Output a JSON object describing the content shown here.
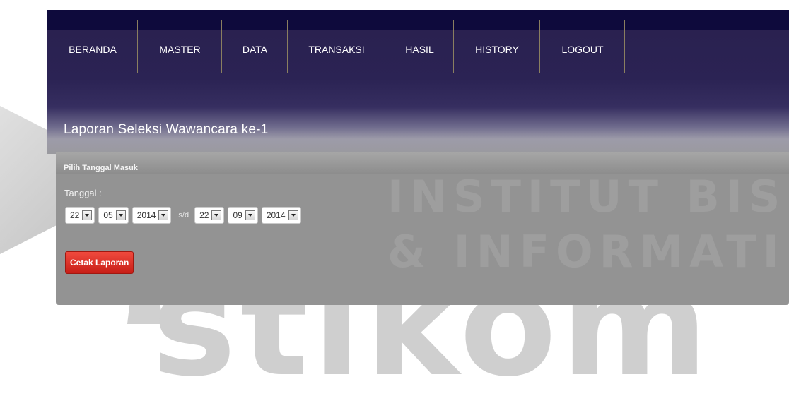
{
  "watermark": {
    "line1": "INSTITUT BISNIS",
    "line2": "& INFORMATIKA",
    "big": "stikom"
  },
  "nav": {
    "items": [
      {
        "label": "BERANDA"
      },
      {
        "label": "MASTER"
      },
      {
        "label": "DATA"
      },
      {
        "label": "TRANSAKSI"
      },
      {
        "label": "HASIL"
      },
      {
        "label": "HISTORY"
      },
      {
        "label": "LOGOUT"
      }
    ]
  },
  "page": {
    "title": "Laporan Seleksi Wawancara ke-1"
  },
  "form": {
    "section_title": "Pilih Tanggal Masuk",
    "date_label": "Tanggal :",
    "from": {
      "day": "22",
      "month": "05",
      "year": "2014"
    },
    "separator": "s/d",
    "to": {
      "day": "22",
      "month": "09",
      "year": "2014"
    },
    "submit_label": "Cetak Laporan"
  },
  "colors": {
    "topbar": "#0e0a3c",
    "header": "#2b2354",
    "panel": "#939393",
    "button": "#d9261d",
    "nav_separator": "#8a7f60"
  }
}
